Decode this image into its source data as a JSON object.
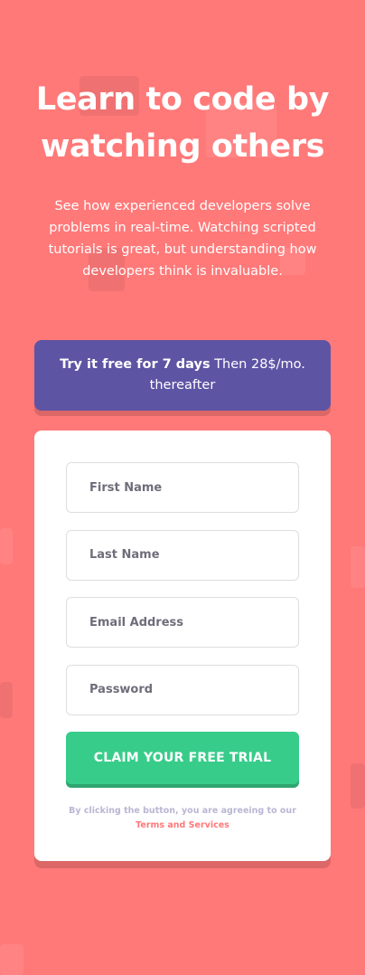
{
  "hero": {
    "title": "Learn to code by watching others",
    "description": "See how experienced developers solve problems in real-time. Watching scripted tutorials is great, but understanding how developers think is invaluable."
  },
  "promo": {
    "highlight": "Try it free for 7 days",
    "rest": " Then 28$/mo. thereafter"
  },
  "form": {
    "first_name_placeholder": "First Name",
    "last_name_placeholder": "Last Name",
    "email_placeholder": "Email Address",
    "password_placeholder": "Password",
    "submit_label": "CLAIM YOUR FREE TRIAL"
  },
  "terms": {
    "prefix": "By clicking the button, you are agreeing to our",
    "link": "Terms and Services"
  },
  "colors": {
    "background": "#ff7979",
    "promo": "#5e54a4",
    "cta": "#38cc8b",
    "card": "#ffffff"
  }
}
